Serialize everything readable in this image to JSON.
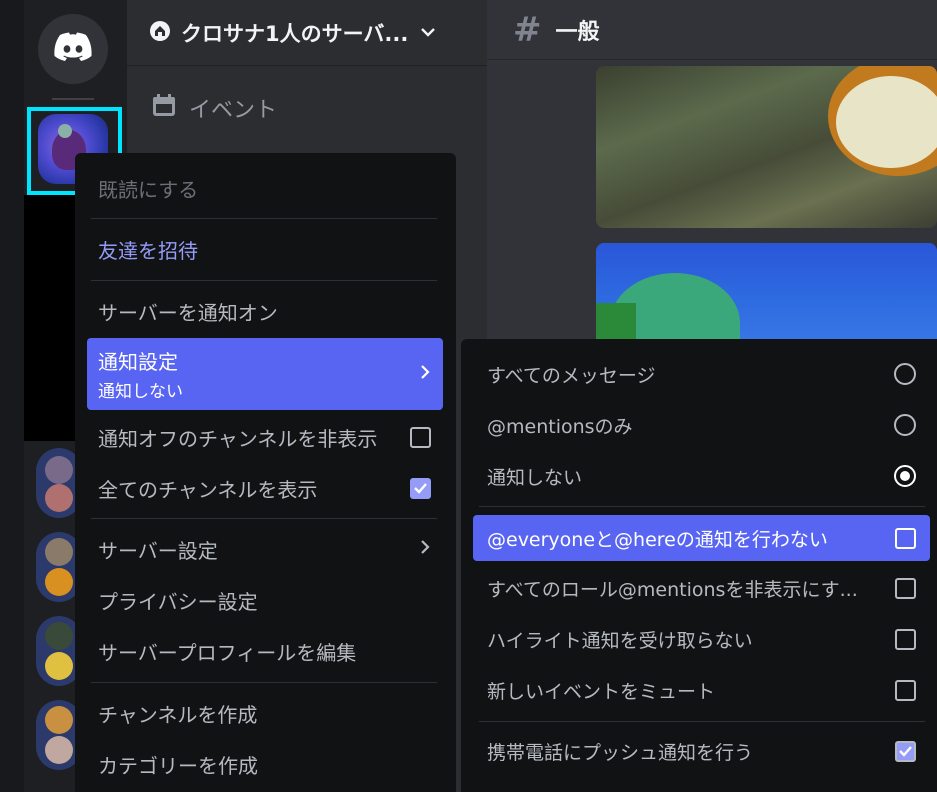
{
  "server": {
    "name": "クロサナ1人のサーバ...",
    "events_label": "イベント"
  },
  "channel": {
    "hash": "#",
    "name": "一般"
  },
  "context_menu": {
    "mark_read": "既読にする",
    "invite": "友達を招待",
    "notify_on": "サーバーを通知オン",
    "notification_settings": "通知設定",
    "notification_settings_value": "通知しない",
    "hide_muted": "通知オフのチャンネルを非表示",
    "hide_muted_checked": false,
    "show_all": "全てのチャンネルを表示",
    "show_all_checked": true,
    "server_settings": "サーバー設定",
    "privacy": "プライバシー設定",
    "edit_profile": "サーバープロフィールを編集",
    "create_channel": "チャンネルを作成",
    "create_category": "カテゴリーを作成"
  },
  "notification_submenu": {
    "all_messages": "すべてのメッセージ",
    "mentions_only": "@mentionsのみ",
    "nothing": "通知しない",
    "selected": "nothing",
    "suppress_everyone": "@everyoneと@hereの通知を行わない",
    "suppress_everyone_checked": false,
    "suppress_roles": "すべてのロール@mentionsを非表示にす...",
    "suppress_roles_checked": false,
    "suppress_highlights": "ハイライト通知を受け取らない",
    "suppress_highlights_checked": false,
    "mute_events": "新しいイベントをミュート",
    "mute_events_checked": false,
    "mobile_push": "携帯電話にプッシュ通知を行う",
    "mobile_push_checked": true
  },
  "colors": {
    "accent": "#5865f2",
    "link": "#949cf7",
    "highlight_box": "#00e5ff"
  }
}
